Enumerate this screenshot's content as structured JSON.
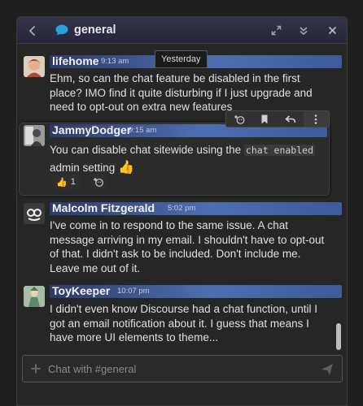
{
  "header": {
    "channel_name": "general",
    "back_icon": "chevron-left-icon",
    "channel_icon": "chat-bubble-icon",
    "expand_icon": "expand-icon",
    "collapse_icon": "double-chevron-down-icon",
    "close_icon": "close-icon",
    "accent_color": "#2d9fdc"
  },
  "date_separator": "Yesterday",
  "messages": [
    {
      "username": "lifehome",
      "time": "9:13 am",
      "text": "Ehm, so can the chat feature be disabled in the first place? IMO find it quite disturbing if I just upgrade and need to opt-out on extra new features"
    },
    {
      "username": "JammyDodger",
      "time": "9:15 am",
      "text_before": "You can disable chat sitewide using the ",
      "code": "chat enabled",
      "text_after": "admin setting ",
      "emoji": "👍",
      "reactions": [
        {
          "emoji": "👍",
          "count": "1"
        }
      ],
      "add_reaction_icon": "add-reaction-icon"
    },
    {
      "username": "Malcolm Fitzgerald",
      "time": "5:02 pm",
      "text": "I've come in to respond to the same issue. A chat message arriving in my email. I shouldn't have to opt-out of that. I didn't ask to be included. Don't include me. Leave me out of it."
    },
    {
      "username": "ToyKeeper",
      "time": "10:07 pm",
      "text": "I didn't even know Discourse had a chat function, until I got an email notification about it. I guess that means I have more UI elements to theme..."
    }
  ],
  "message_actions": [
    "add-reaction-icon",
    "bookmark-icon",
    "reply-icon",
    "more-icon"
  ],
  "composer": {
    "placeholder": "Chat with #general",
    "plus_icon": "plus-icon",
    "send_icon": "send-icon"
  }
}
